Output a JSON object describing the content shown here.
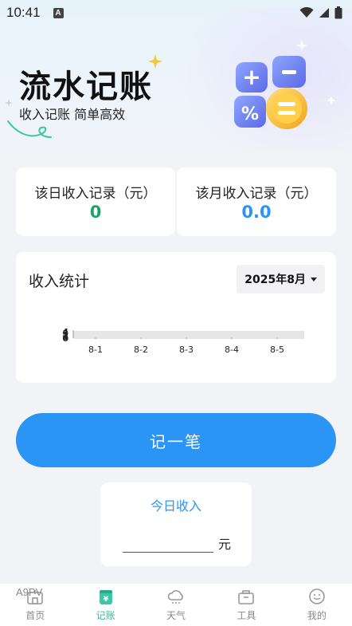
{
  "status_bar": {
    "time": "10:41"
  },
  "hero": {
    "title": "流水记账",
    "subtitle": "收入记账 简单高效"
  },
  "summary": {
    "day": {
      "label": "该日收入记录（元）",
      "value": "0",
      "color": "#22a06b"
    },
    "month": {
      "label": "该月收入记录（元）",
      "value": "0.0",
      "color": "#2b95f5"
    }
  },
  "chart_card": {
    "title": "收入统计",
    "month_selector": "2025年8月"
  },
  "chart_data": {
    "type": "line",
    "categories": [
      "8-1",
      "8-2",
      "8-3",
      "8-4",
      "8-5"
    ],
    "series": [
      {
        "values": [
          0,
          0,
          0,
          0,
          0
        ]
      }
    ],
    "y_tick_labels": [
      "0",
      "1",
      "2",
      "3",
      "4"
    ],
    "grid": true
  },
  "record_button": {
    "label": "记一笔"
  },
  "income_entry": {
    "title": "今日收入",
    "value": "",
    "unit": "元"
  },
  "watermark": "A9PV",
  "tabbar": {
    "items": [
      {
        "label": "首页",
        "icon": "home-icon"
      },
      {
        "label": "记账",
        "icon": "ledger-icon",
        "active": true
      },
      {
        "label": "天气",
        "icon": "cloud-icon"
      },
      {
        "label": "工具",
        "icon": "toolbox-icon"
      },
      {
        "label": "我的",
        "icon": "smiley-icon"
      }
    ]
  }
}
